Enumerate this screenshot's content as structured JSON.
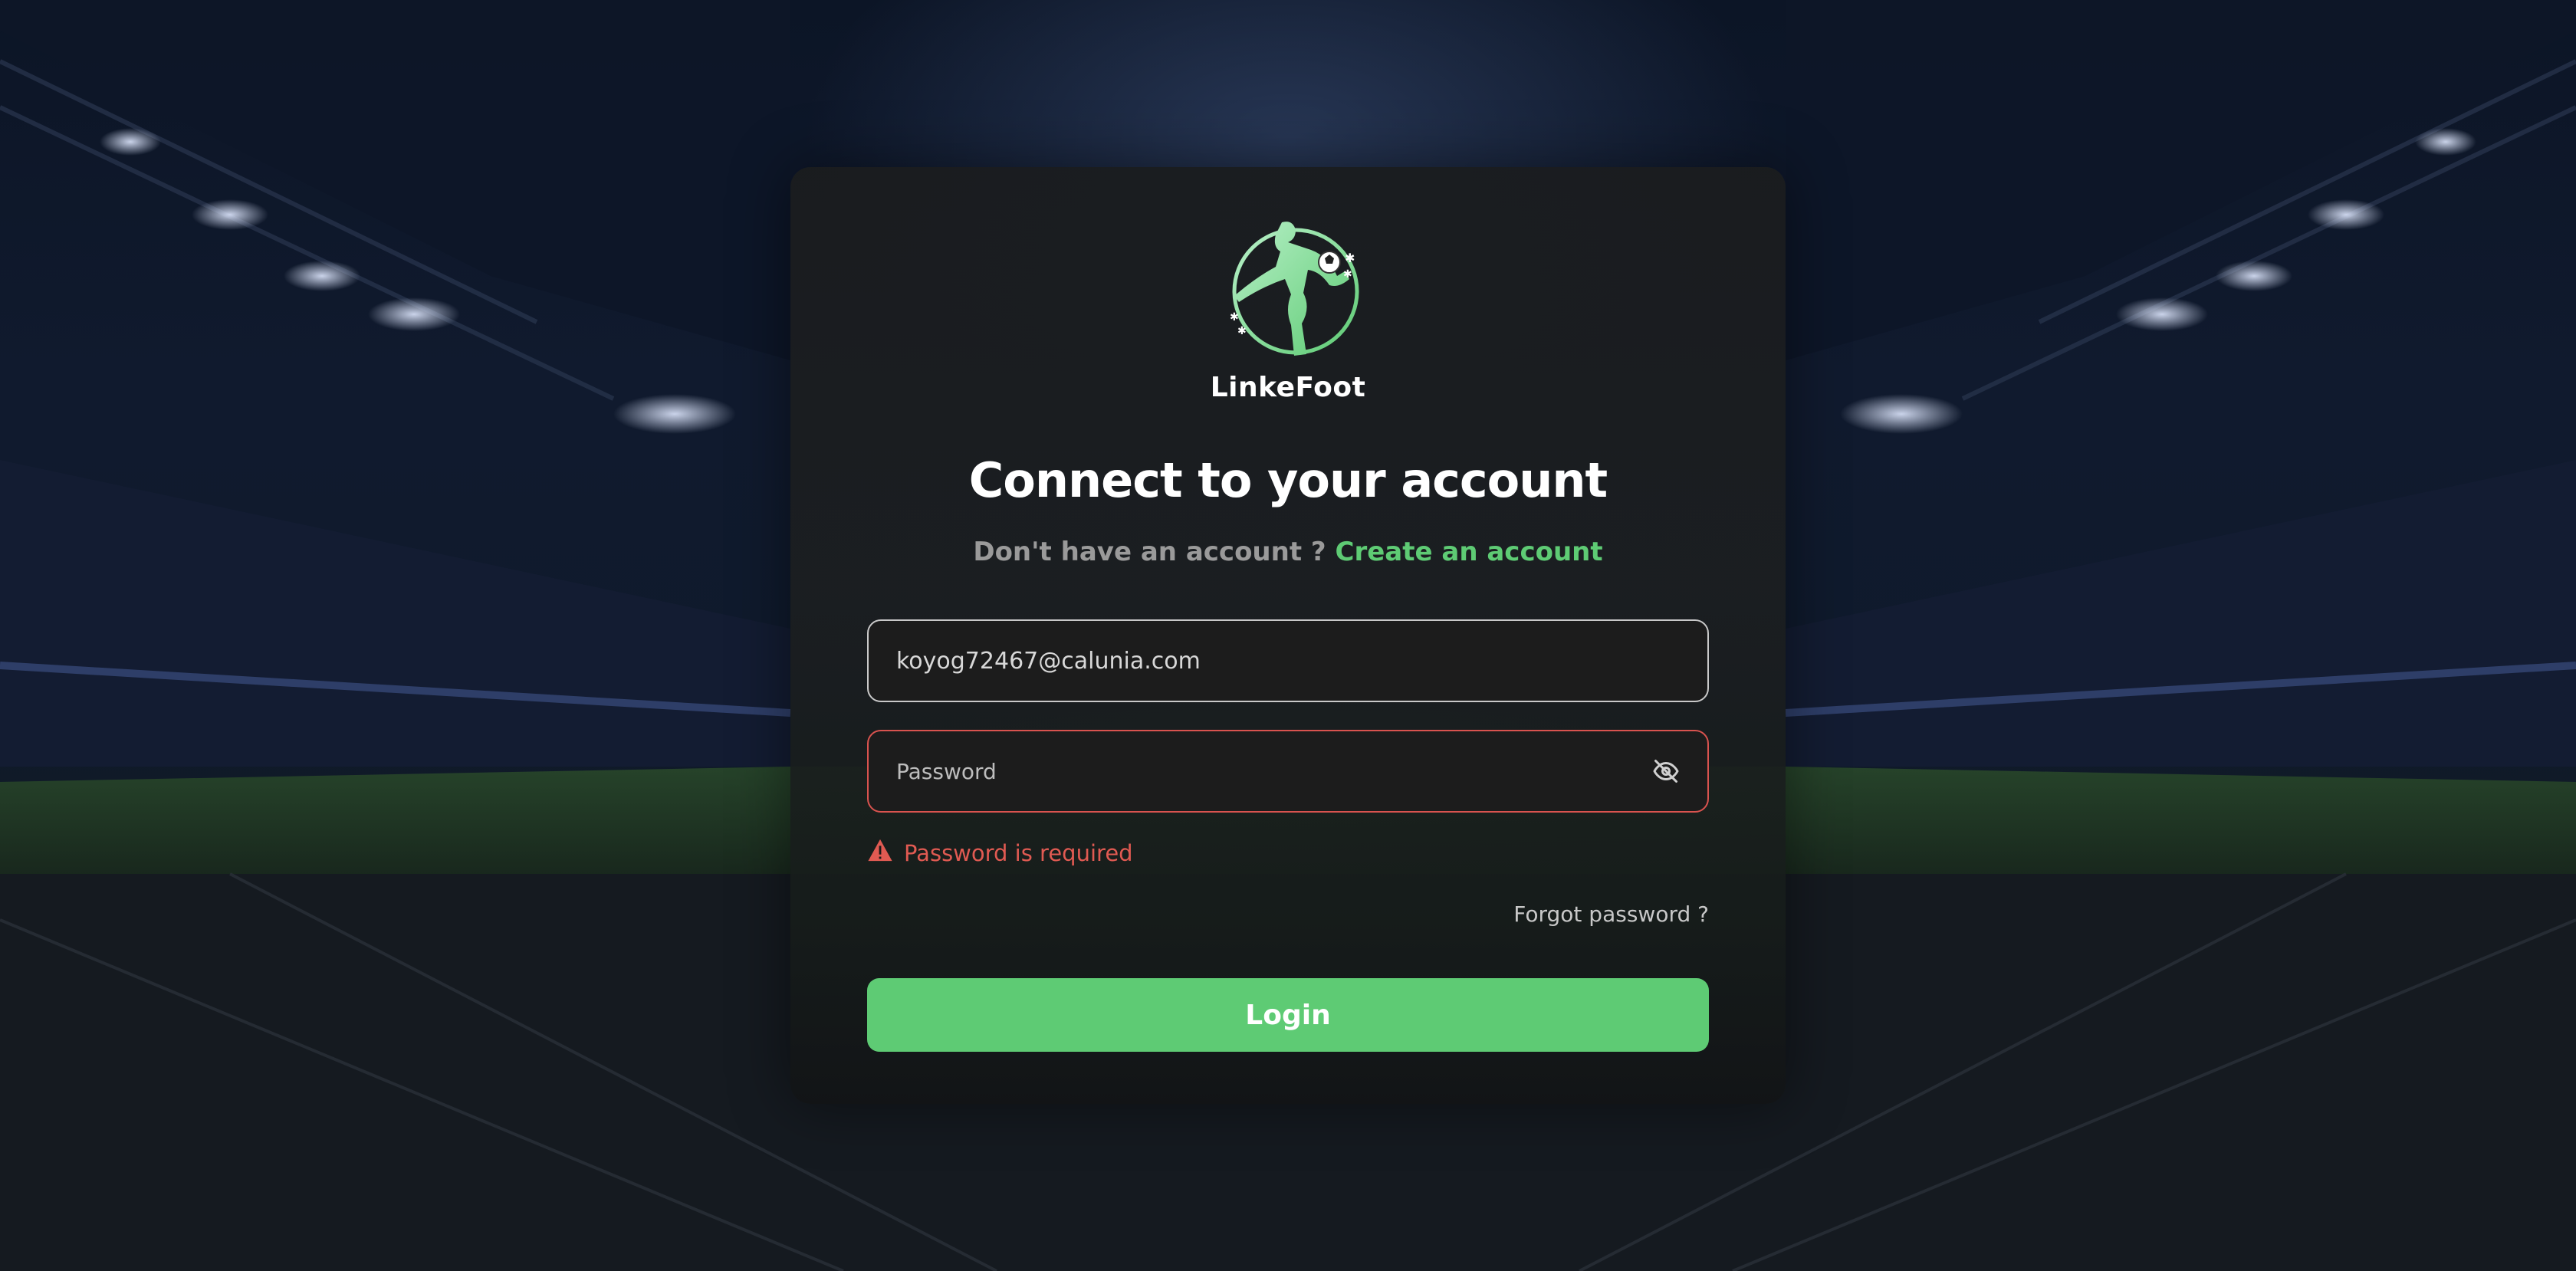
{
  "brand": {
    "name": "LinkeFoot",
    "logo_icon": "soccer-player-kick-icon",
    "accent_color": "#5ecb74"
  },
  "login": {
    "title": "Connect to your account",
    "prompt": "Don't have an account ?",
    "create_account_link": "Create an account",
    "email_value": "koyog72467@calunia.com",
    "password_placeholder": "Password",
    "password_toggle_icon": "eye-slash-icon",
    "error_message": "Password is required",
    "error_icon": "warning-triangle-icon",
    "error_color": "#e05a52",
    "forgot_password": "Forgot password ?",
    "login_button": "Login"
  }
}
